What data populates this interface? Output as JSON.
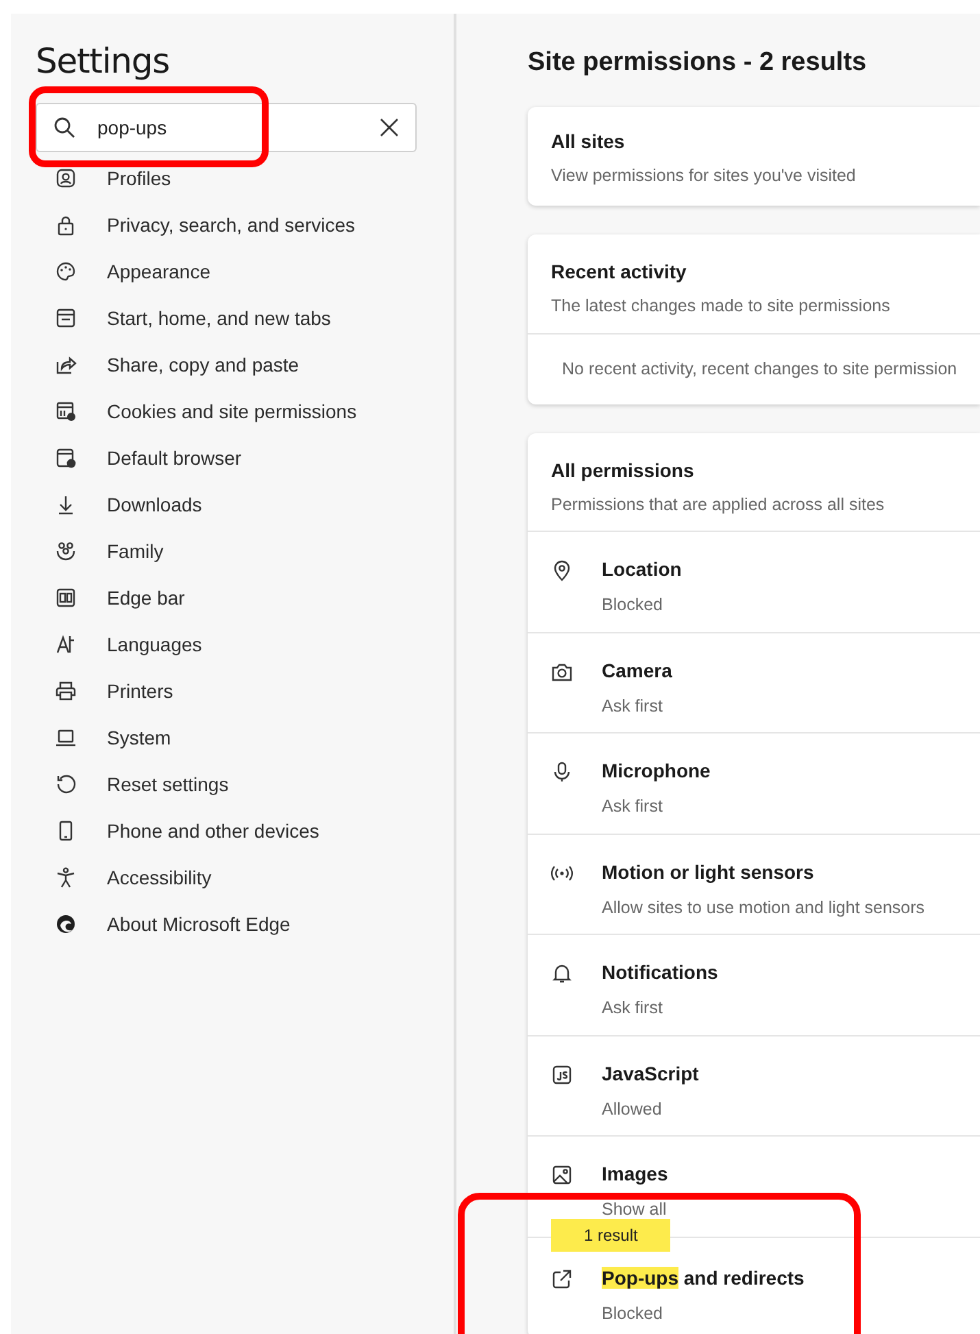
{
  "sidebar": {
    "title": "Settings",
    "search": {
      "value": "pop-ups"
    },
    "items": [
      {
        "label": "Profiles"
      },
      {
        "label": "Privacy, search, and services"
      },
      {
        "label": "Appearance"
      },
      {
        "label": "Start, home, and new tabs"
      },
      {
        "label": "Share, copy and paste"
      },
      {
        "label": "Cookies and site permissions"
      },
      {
        "label": "Default browser"
      },
      {
        "label": "Downloads"
      },
      {
        "label": "Family"
      },
      {
        "label": "Edge bar"
      },
      {
        "label": "Languages"
      },
      {
        "label": "Printers"
      },
      {
        "label": "System"
      },
      {
        "label": "Reset settings"
      },
      {
        "label": "Phone and other devices"
      },
      {
        "label": "Accessibility"
      },
      {
        "label": "About Microsoft Edge"
      }
    ]
  },
  "main": {
    "title": "Site permissions - 2 results",
    "all_sites": {
      "title": "All sites",
      "subtitle": "View permissions for sites you've visited"
    },
    "recent_activity": {
      "title": "Recent activity",
      "subtitle": "The latest changes made to site permissions",
      "empty_message": "No recent activity, recent changes to site permission"
    },
    "all_permissions": {
      "title": "All permissions",
      "subtitle": "Permissions that are applied across all sites",
      "rows": [
        {
          "name": "Location",
          "status": "Blocked"
        },
        {
          "name": "Camera",
          "status": "Ask first"
        },
        {
          "name": "Microphone",
          "status": "Ask first"
        },
        {
          "name": "Motion or light sensors",
          "status": "Allow sites to use motion and light sensors"
        },
        {
          "name": "Notifications",
          "status": "Ask first"
        },
        {
          "name": "JavaScript",
          "status": "Allowed"
        },
        {
          "name": "Images",
          "status": "Show all"
        },
        {
          "match": "Pop-ups",
          "name": "and redirects",
          "status": "Blocked",
          "result_badge": "1 result"
        }
      ]
    }
  }
}
